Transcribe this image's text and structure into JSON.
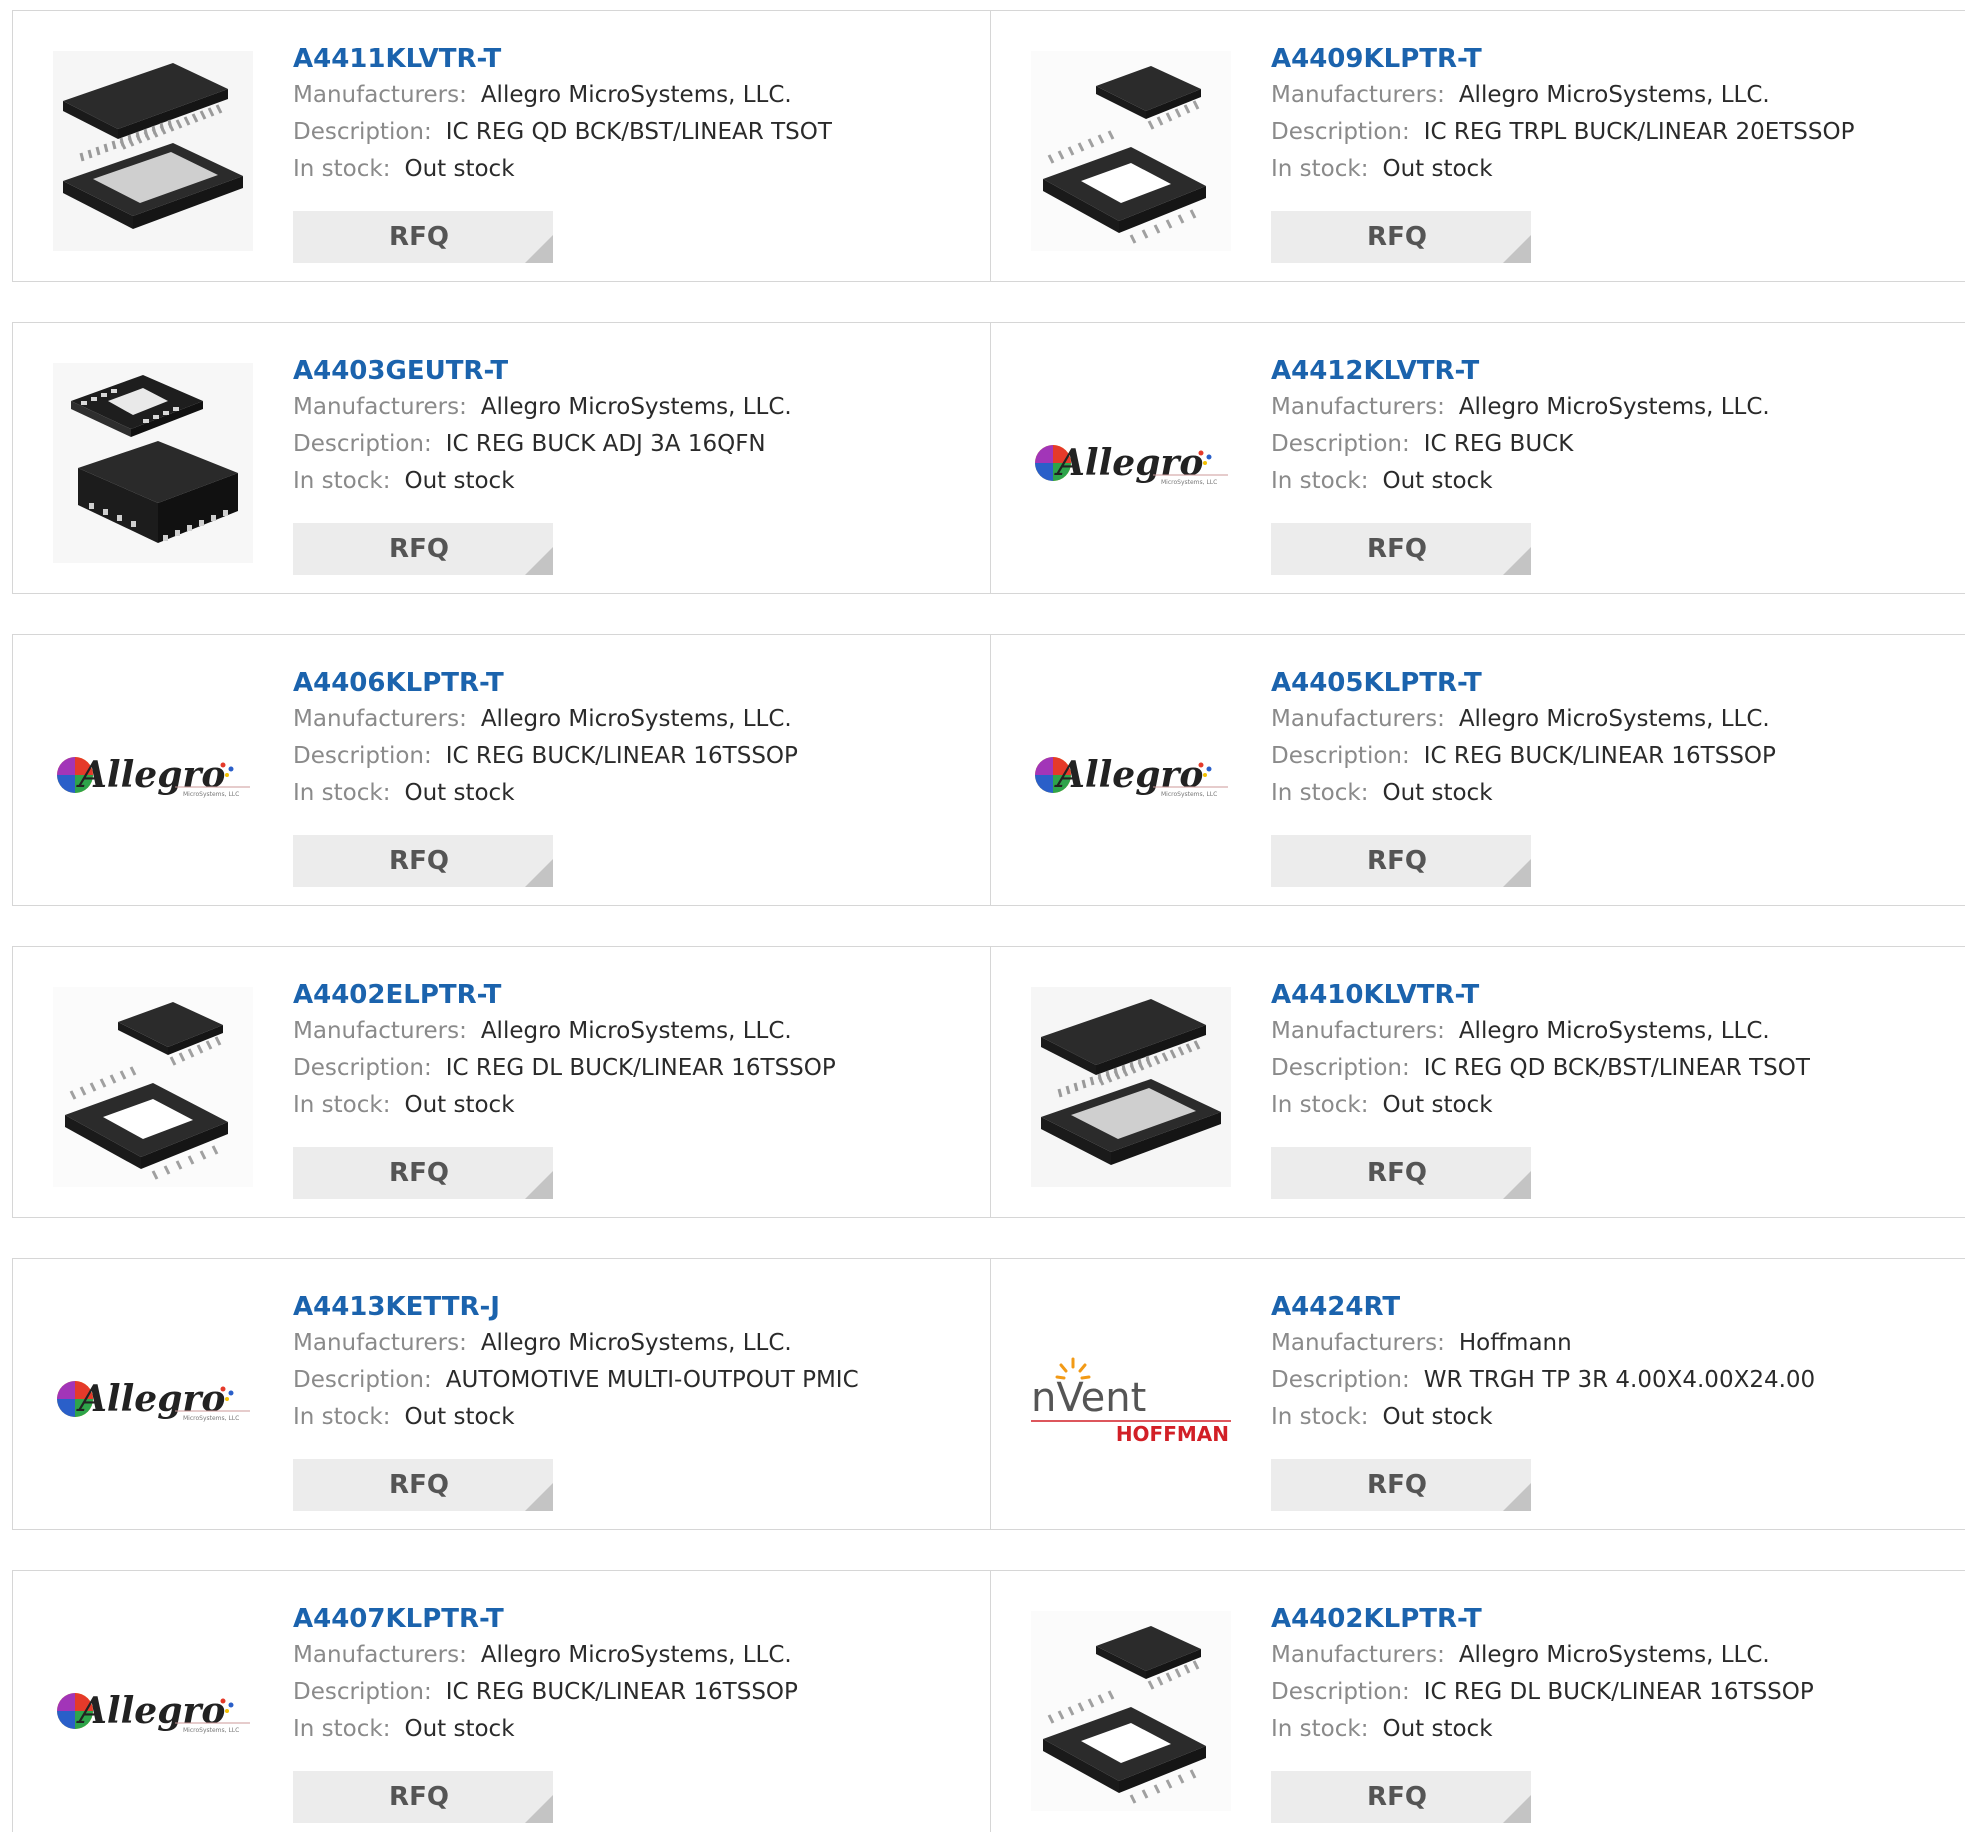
{
  "labels": {
    "manufacturers": "Manufacturers:",
    "description": "Description:",
    "in_stock": "In stock:",
    "rfq": "RFQ"
  },
  "products": [
    {
      "part": "A4411KLVTR-T",
      "manufacturer": "Allegro MicroSystems, LLC.",
      "description": "IC REG QD BCK/BST/LINEAR TSOT",
      "stock": "Out stock",
      "image": "tssop-wide-chip-image"
    },
    {
      "part": "A4409KLPTR-T",
      "manufacturer": "Allegro MicroSystems, LLC.",
      "description": "IC REG TRPL BUCK/LINEAR 20ETSSOP",
      "stock": "Out stock",
      "image": "tssop-chip-image"
    },
    {
      "part": "A4403GEUTR-T",
      "manufacturer": "Allegro MicroSystems, LLC.",
      "description": "IC REG BUCK ADJ 3A 16QFN",
      "stock": "Out stock",
      "image": "qfn-chip-image"
    },
    {
      "part": "A4412KLVTR-T",
      "manufacturer": "Allegro MicroSystems, LLC.",
      "description": "IC REG BUCK",
      "stock": "Out stock",
      "image": "allegro-logo"
    },
    {
      "part": "A4406KLPTR-T",
      "manufacturer": "Allegro MicroSystems, LLC.",
      "description": "IC REG BUCK/LINEAR 16TSSOP",
      "stock": "Out stock",
      "image": "allegro-logo"
    },
    {
      "part": "A4405KLPTR-T",
      "manufacturer": "Allegro MicroSystems, LLC.",
      "description": "IC REG BUCK/LINEAR 16TSSOP",
      "stock": "Out stock",
      "image": "allegro-logo"
    },
    {
      "part": "A4402ELPTR-T",
      "manufacturer": "Allegro MicroSystems, LLC.",
      "description": "IC REG DL BUCK/LINEAR 16TSSOP",
      "stock": "Out stock",
      "image": "tssop-chip-image"
    },
    {
      "part": "A4410KLVTR-T",
      "manufacturer": "Allegro MicroSystems, LLC.",
      "description": "IC REG QD BCK/BST/LINEAR TSOT",
      "stock": "Out stock",
      "image": "tssop-wide-chip-image"
    },
    {
      "part": "A4413KETTR-J",
      "manufacturer": "Allegro MicroSystems, LLC.",
      "description": "AUTOMOTIVE MULTI-OUTPOUT PMIC",
      "stock": "Out stock",
      "image": "allegro-logo"
    },
    {
      "part": "A4424RT",
      "manufacturer": "Hoffmann",
      "description": "WR TRGH TP 3R 4.00X4.00X24.00",
      "stock": "Out stock",
      "image": "nvent-hoffman-logo"
    },
    {
      "part": "A4407KLPTR-T",
      "manufacturer": "Allegro MicroSystems, LLC.",
      "description": "IC REG BUCK/LINEAR 16TSSOP",
      "stock": "Out stock",
      "image": "allegro-logo"
    },
    {
      "part": "A4402KLPTR-T",
      "manufacturer": "Allegro MicroSystems, LLC.",
      "description": "IC REG DL BUCK/LINEAR 16TSSOP",
      "stock": "Out stock",
      "image": "tssop-chip-image"
    }
  ]
}
